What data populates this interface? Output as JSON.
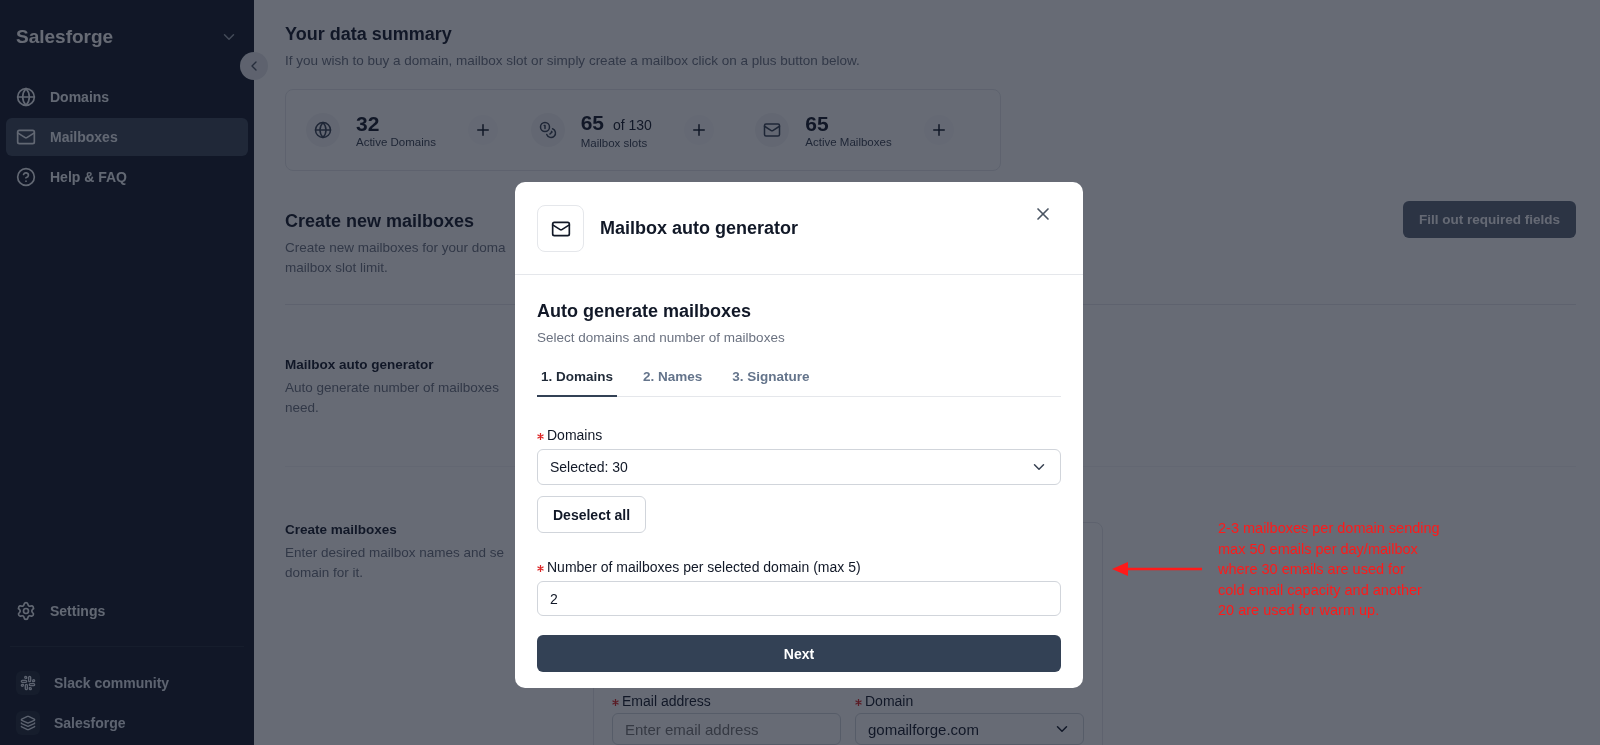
{
  "sidebar": {
    "brand": "Salesforge",
    "items": [
      {
        "label": "Domains",
        "selected": false
      },
      {
        "label": "Mailboxes",
        "selected": true
      },
      {
        "label": "Help & FAQ",
        "selected": false
      }
    ],
    "settings": {
      "label": "Settings"
    },
    "links": [
      {
        "label": "Slack community"
      },
      {
        "label": "Salesforge"
      }
    ]
  },
  "summary": {
    "title": "Your data summary",
    "subtitle": "If you wish to buy a domain, mailbox slot or simply create a mailbox click on a plus button below.",
    "stats": [
      {
        "value": "32",
        "label": "Active Domains"
      },
      {
        "value": "65",
        "suffix": "of 130",
        "label": "Mailbox slots"
      },
      {
        "value": "65",
        "label": "Active Mailboxes"
      }
    ]
  },
  "create": {
    "title": "Create new mailboxes",
    "description": "Create new mailboxes for your doma\nmailbox slot limit.",
    "submit_button": {
      "label": "Fill out required fields",
      "disabled": true
    },
    "sections": [
      {
        "title": "Mailbox auto generator",
        "description": "Auto generate number of mailboxes\nneed."
      },
      {
        "title": "Create mailboxes",
        "description": "Enter desired mailbox names and se\ndomain for it."
      }
    ],
    "form": {
      "email_label": "Email address",
      "email_required": true,
      "email_placeholder": "Enter email address",
      "domain_label": "Domain",
      "domain_required": true,
      "domain_value": "gomailforge.com"
    }
  },
  "modal": {
    "title": "Mailbox auto generator",
    "heading": "Auto generate mailboxes",
    "subtitle": "Select domains and number of mailboxes",
    "tabs": [
      {
        "label": "1. Domains",
        "selected": true
      },
      {
        "label": "2. Names",
        "selected": false
      },
      {
        "label": "3. Signature",
        "selected": false
      }
    ],
    "domains_label": "Domains",
    "domains_required": true,
    "domains_value": "Selected: 30",
    "deselect_button": "Deselect all",
    "count_label": "Number of mailboxes per selected domain (max 5)",
    "count_required": true,
    "count_value": "2",
    "next_button": "Next"
  },
  "annotation": {
    "text": "2-3 mailboxes per domain sending\nmax 50 emails per day/mailbox\nwhere 30 emails are used for\ncold email capacity and another\n20 are used for warm up."
  }
}
